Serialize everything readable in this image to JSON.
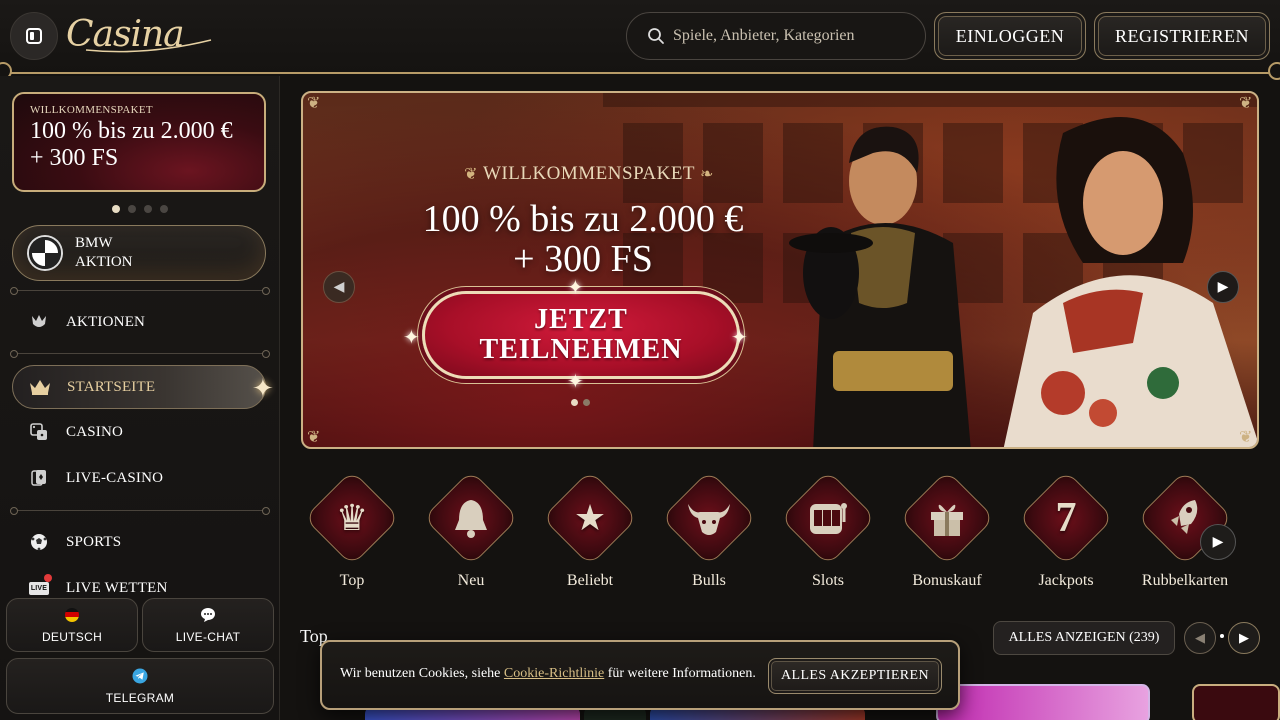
{
  "header": {
    "logo_text": "Casina",
    "search_placeholder": "Spiele, Anbieter, Kategorien",
    "login_label": "EINLOGGEN",
    "register_label": "REGISTRIEREN"
  },
  "sidebar": {
    "promo": {
      "tag": "WILLKOMMENSPAKET",
      "line1": "100 % bis zu 2.000 €",
      "line2": "+ 300 FS"
    },
    "bmw": {
      "line1": "BMW",
      "line2": "AKTION"
    },
    "items": [
      {
        "label": "AKTIONEN",
        "icon": "tulip-icon"
      },
      {
        "label": "STARTSEITE",
        "icon": "crown-icon",
        "active": true
      },
      {
        "label": "CASINO",
        "icon": "dice-icon"
      },
      {
        "label": "LIVE-CASINO",
        "icon": "cards-icon"
      },
      {
        "label": "SPORTS",
        "icon": "soccer-ball-icon"
      },
      {
        "label": "LIVE WETTEN",
        "icon": "live-icon"
      }
    ],
    "live_badge": "LIVE",
    "bottom": {
      "language": "DEUTSCH",
      "chat": "LIVE-CHAT",
      "telegram": "TELEGRAM"
    }
  },
  "hero": {
    "tag": "WILLKOMMENSPAKET",
    "title_line1": "100 % bis zu 2.000 €",
    "title_line2": "+ 300 FS",
    "cta_line1": "JETZT",
    "cta_line2": "TEILNEHMEN"
  },
  "categories": [
    {
      "label": "Top",
      "icon": "crown-icon"
    },
    {
      "label": "Neu",
      "icon": "bell-icon"
    },
    {
      "label": "Beliebt",
      "icon": "star-icon"
    },
    {
      "label": "Bulls",
      "icon": "bull-icon"
    },
    {
      "label": "Slots",
      "icon": "slot-machine-icon"
    },
    {
      "label": "Bonuskauf",
      "icon": "gift-icon"
    },
    {
      "label": "Jackpots",
      "icon": "seven-icon"
    },
    {
      "label": "Rubbelkarten",
      "icon": "rocket-icon"
    }
  ],
  "top_section": {
    "title": "Top",
    "show_all": "ALLES ANZEIGEN (239)"
  },
  "cookie": {
    "text_before": "Wir benutzen Cookies, siehe",
    "link": "Cookie-Richtlinie",
    "text_after": "für weitere Informationen.",
    "accept": "ALLES AKZEPTIEREN"
  },
  "colors": {
    "gold": "#cbb185",
    "accent_red": "#a80f28",
    "background": "#141210"
  }
}
